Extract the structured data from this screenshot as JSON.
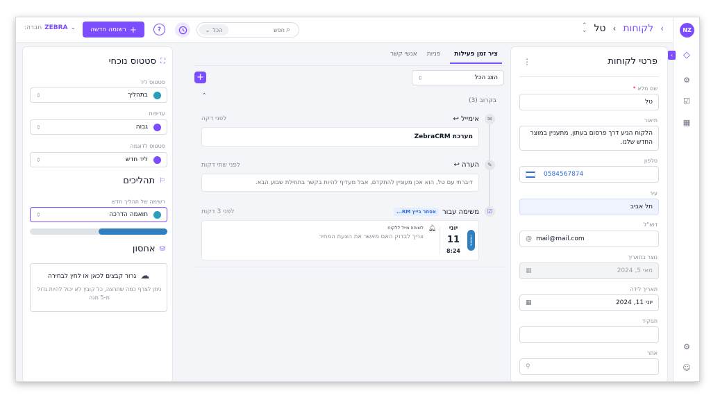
{
  "colors": {
    "accent": "#7c4dff",
    "teal": "#2aa0b8",
    "blue": "#2f7fc1",
    "light_blue_bg": "#eef3ff"
  },
  "topbar": {
    "company_label": "חברה:",
    "company_value": "ZEBRA",
    "new_record_label": "רשומה חדשה",
    "filter_label": "הכל",
    "search_placeholder": "חפש",
    "breadcrumb_root": "לקוחות",
    "breadcrumb_current": "טל",
    "avatar": "NZ"
  },
  "details": {
    "title": "פרטי לקוחות",
    "fields": [
      {
        "label": "שם מלא",
        "required": "*",
        "value": "טל"
      },
      {
        "label": "תיאור",
        "value": "הלקוח הגיע דרך פרסום בעתון, מתעניין במוצר החדש שלנו."
      },
      {
        "label": "טלפון",
        "value": "0584567874"
      },
      {
        "label": "עיר",
        "value": "תל אביב"
      },
      {
        "label": "דוא\"ל",
        "value": "mail@mail.com"
      },
      {
        "label": "נוצר בתאריך",
        "value": "מאי 5, 2024"
      },
      {
        "label": "תאריך לידה",
        "value": "יוני 11, 2024"
      },
      {
        "label": "תפקיד",
        "value": ""
      },
      {
        "label": "אתר",
        "value": ""
      }
    ]
  },
  "activity": {
    "tabs": [
      "ציר זמן פעילות",
      "פניות",
      "אנשי קשר"
    ],
    "show_all": "הצג הכל",
    "upcoming": "בקרוב (3)",
    "items": [
      {
        "type": "אימייל",
        "time": "לפני דקה",
        "body": "מערכת ZebraCRM"
      },
      {
        "type": "הערה",
        "time": "לפני שתי דקות",
        "body": "דיברתי עם טל, הוא אכן מעוניין להתקדם, אבל מעדיף להיות בקשר בתחילת שבוע הבא."
      },
      {
        "type": "משימה עבור",
        "assignee": "אסתר בייץ RM...",
        "time": "לפני 3 דקות",
        "day_name": "יוני",
        "day_num": "11",
        "hour": "8:24",
        "badge": "משימה",
        "task_title": "לשוחח מייל ללקוח",
        "task_body": "צריך לבדוק האם מאשר את הצעת המחיר"
      }
    ]
  },
  "status": {
    "title": "סטטוס נוכחי",
    "lead_status_label": "סטטוס ליד",
    "lead_status_value": "בתהליך",
    "priority_label": "עדיפות",
    "priority_value": "גבוה",
    "order_status_label": "סטטוס לדוגמה",
    "order_status_value": "ליד חדש",
    "processes_title": "תהליכים",
    "new_process_label": "רשימה של תהליך חדש",
    "process_value": "תואמה הדרכה",
    "storage_title": "אחסון",
    "upload_text": "גרור קבצים לכאן או לחץ לבחירה",
    "upload_note": "ניתן לצרף כמה שתרצה, כל קובץ לא יכול להיות גדול מ-5 מגה"
  }
}
